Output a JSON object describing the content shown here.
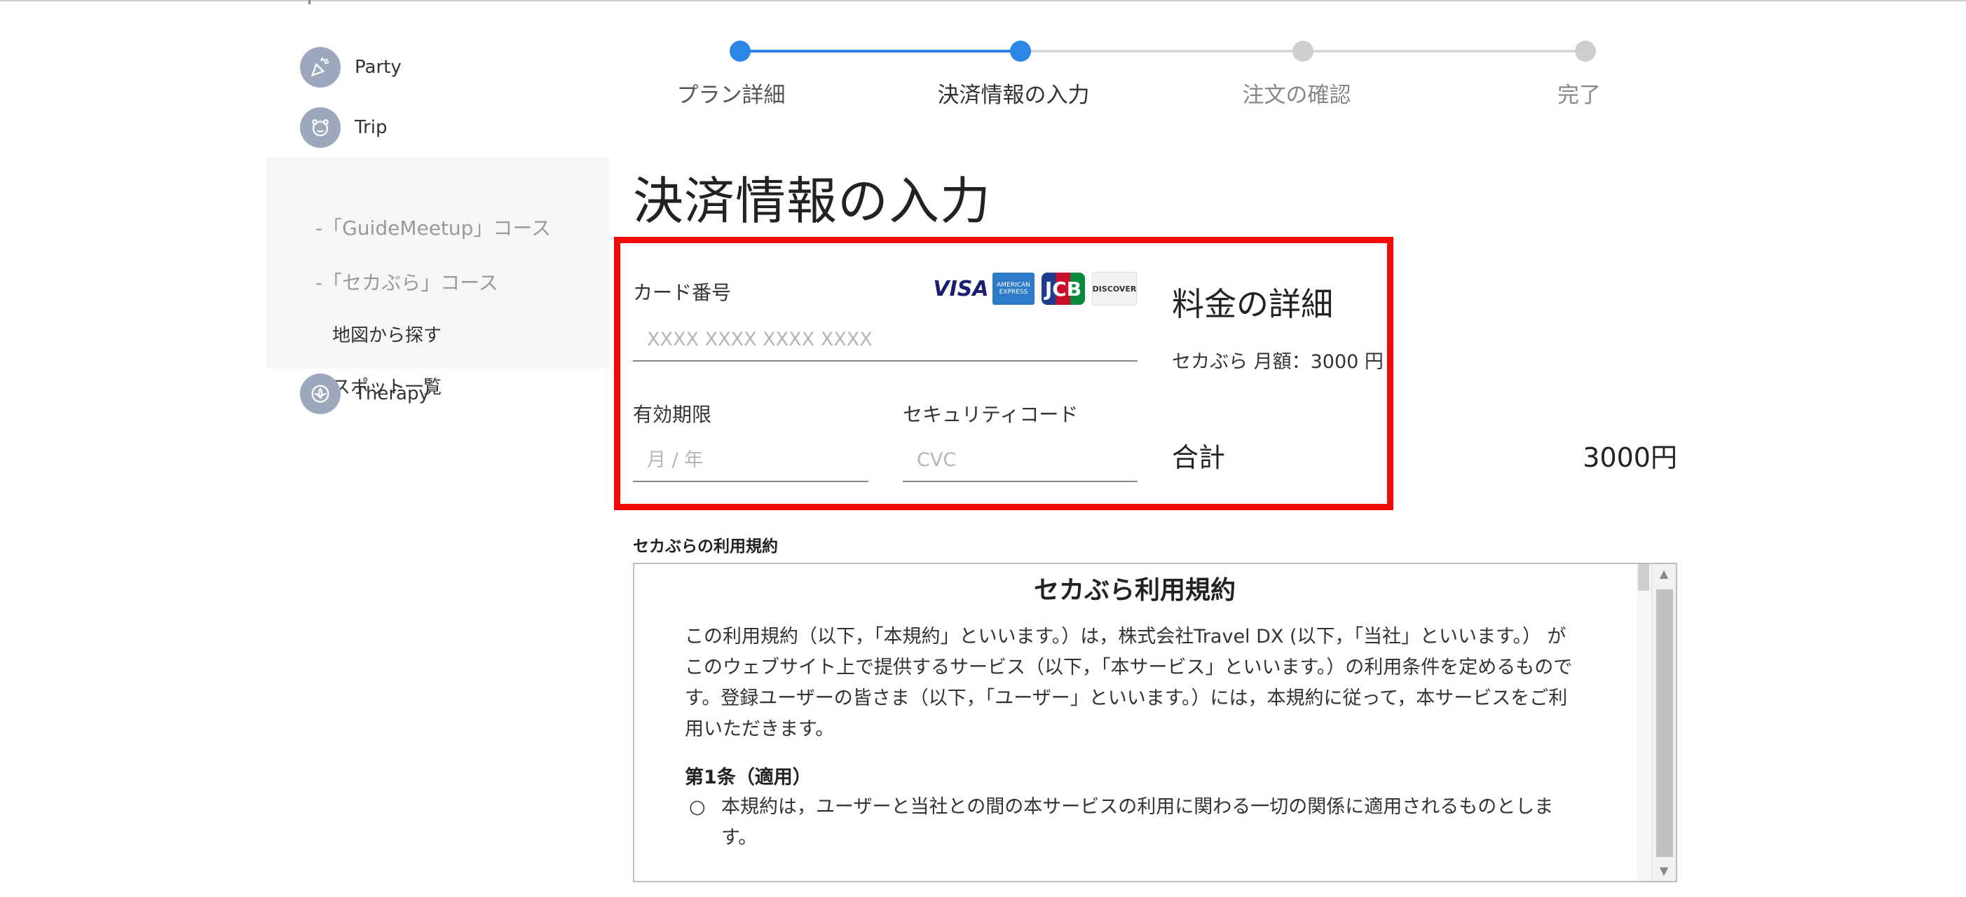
{
  "sidebar": {
    "items": [
      {
        "label": "Party",
        "icon": "party-popper-icon"
      },
      {
        "label": "Trip",
        "icon": "bear-face-icon"
      },
      {
        "label": "Therapy",
        "icon": "spa-lotus-icon"
      }
    ],
    "sub_items": [
      "-「GuideMeetup」コース",
      "-「セカぶら」コース",
      "地図から探す",
      "スポット一覧"
    ]
  },
  "stepper": {
    "steps": [
      "プラン詳細",
      "決済情報の入力",
      "注文の確認",
      "完了"
    ],
    "current_index": 1
  },
  "page_title": "決済情報の入力",
  "payment": {
    "card_number_label": "カード番号",
    "card_number_placeholder": "XXXX XXXX XXXX XXXX",
    "expiry_label": "有効期限",
    "expiry_placeholder": "月 / 年",
    "cvc_label": "セキュリティコード",
    "cvc_placeholder": "CVC",
    "cards": {
      "visa": "VISA",
      "amex": "AMERICAN EXPRESS",
      "jcb": "JCB",
      "discover": "DISCOVER"
    }
  },
  "fees": {
    "title": "料金の詳細",
    "line": "セカぶら 月額：3000 円",
    "total_label": "合計",
    "total_value": "3000円"
  },
  "terms": {
    "heading": "セカぶらの利用規約",
    "title": "セカぶら利用規約",
    "intro": "この利用規約（以下，「本規約」といいます。）は，株式会社Travel DX (以下，「当社」といいます。） がこのウェブサイト上で提供するサービス（以下，「本サービス」といいます。）の利用条件を定めるものです。登録ユーザーの皆さま（以下，「ユーザー」といいます。）には，本規約に従って，本サービスをご利用いただきます。",
    "article1_title": "第1条（適用）",
    "article1_item1": "本規約は，ユーザーと当社との間の本サービスの利用に関わる一切の関係に適用されるものとします。"
  },
  "colors": {
    "accent": "#2b86e5",
    "highlight": "#f00a0a",
    "icon_bg": "#9da8bd"
  }
}
